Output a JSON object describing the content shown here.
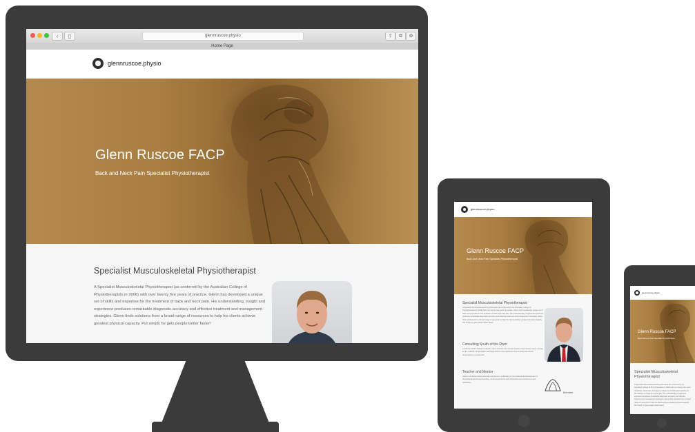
{
  "browser": {
    "url": "glennruscoe.physio",
    "tab_title": "Home Page",
    "traffic_lights": [
      "#ee5a52",
      "#f2b632",
      "#45c042"
    ]
  },
  "site": {
    "name": "glennruscoe.physio",
    "hero_title": "Glenn Ruscoe FACP",
    "hero_subtitle": "Back and Neck Pain Specialist Physiotherapist",
    "section_heading": "Specialist Musculoskeletal Physiotherapist",
    "section_text": "A Specialist Musculoskeletal Physiotherapist (as conferred by the Australian College of Physiotherapists in 2008) with over twenty five years of practice, Glenn has developed a unique set of skills and expertise for the treatment of back and neck pain. His understanding, insight and experience produces remarkable diagnostic accuracy and effective treatment and management strategies. Glenn finds solutions from a broad range of resources to help his clients achieve greatest physical capacity. Put simply he gets people better faster!",
    "section2_heading": "Consulting South of the River",
    "section2_text": "Located in Perth's Western suburbs, Glenn consults from private practice and provides expert reviews for the medical, compensation and legal sectors. His experience covers acute and chronic presentations of spinal pain.",
    "section3_heading": "Teacher and Mentor",
    "section3_text": "Glenn is an active clinical educator and mentor, contributing to the professional development of physiotherapists through teaching, clinical supervision and presentations at conferences and workshops.",
    "badge_text": "Member"
  },
  "colors": {
    "device_frame": "#3b3b3b",
    "hero_tone": "#a97d40",
    "heading": "#444444",
    "tie": "#c8232b"
  }
}
